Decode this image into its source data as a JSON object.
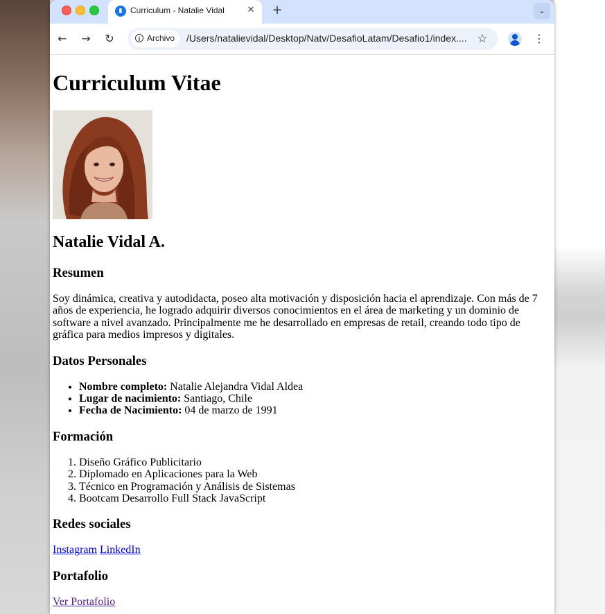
{
  "browser": {
    "tab_title": "Curriculum - Natalie Vidal",
    "tab_close": "✕",
    "new_tab": "+",
    "tab_menu": "⌄",
    "back": "←",
    "forward": "→",
    "reload": "↻",
    "chip_icon": "i",
    "chip_label": "Archivo",
    "url": "/Users/natalievidal/Desktop/Natv/DesafioLatam/Desafio1/index....",
    "bookmark": "☆",
    "menu": "⋮"
  },
  "page": {
    "title": "Curriculum Vitae",
    "name": "Natalie Vidal A.",
    "summary_heading": "Resumen",
    "summary": "Soy dinámica, creativa y autodidacta, poseo alta motivación y disposición hacia el aprendizaje. Con más de 7 años de experiencia, he logrado adquirir diversos conocimientos en el área de marketing y un dominio de software a nivel avanzado. Principalmente me he desarrollado en empresas de retail, creando todo tipo de gráfica para medios impresos y digitales.",
    "personal_heading": "Datos Personales",
    "personal": [
      {
        "label": "Nombre completo:",
        "value": " Natalie Alejandra Vidal Aldea"
      },
      {
        "label": "Lugar de nacimiento:",
        "value": " Santiago, Chile"
      },
      {
        "label": "Fecha de Nacimiento:",
        "value": " 04 de marzo de 1991"
      }
    ],
    "education_heading": "Formación",
    "education": [
      "Diseño Gráfico Publicitario",
      "Diplomado en Aplicaciones para la Web",
      "Técnico en Programación y Análisis de Sistemas",
      "Bootcam Desarrollo Full Stack JavaScript"
    ],
    "social_heading": "Redes sociales",
    "social": [
      "Instagram",
      "LinkedIn"
    ],
    "portfolio_heading": "Portafolio",
    "portfolio_link": "Ver Portafolio"
  },
  "colors": {
    "tabstrip": "#d3e3fd",
    "link": "#0000ee",
    "visited_link": "#551a8b"
  }
}
